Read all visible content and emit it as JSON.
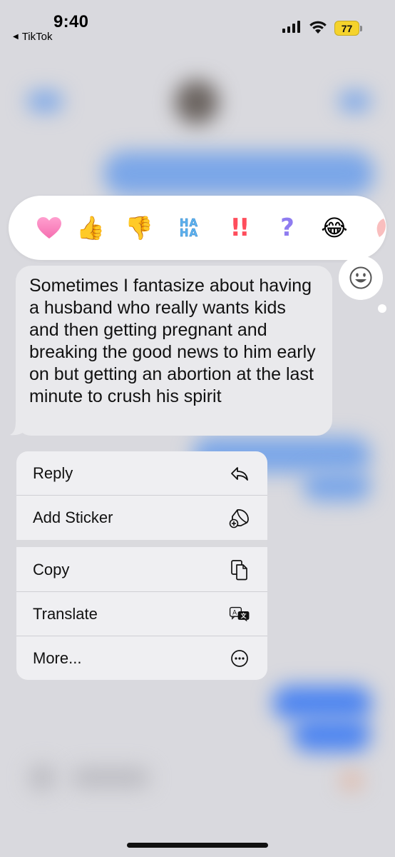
{
  "status_bar": {
    "time": "9:40",
    "back_app_label": "TikTok",
    "battery_level": "77",
    "battery_color": "#f5d32c"
  },
  "tapbacks": {
    "items": [
      {
        "name": "heart",
        "glyph": "❤️"
      },
      {
        "name": "thumbs-up",
        "glyph": "👍"
      },
      {
        "name": "thumbs-down",
        "glyph": "👎"
      },
      {
        "name": "haha",
        "glyph": "HA HA"
      },
      {
        "name": "emphasis",
        "glyph": "‼"
      },
      {
        "name": "question",
        "glyph": "?"
      },
      {
        "name": "laughing",
        "glyph": "😂"
      },
      {
        "name": "more-emoji",
        "glyph": "🫶"
      }
    ],
    "emoji_picker_icon": "smiley-icon"
  },
  "message": {
    "text": "Sometimes I fantasize about having a husband who really wants kids and then getting pregnant and breaking the good news to him early on but getting an abortion at the last minute to crush his spirit",
    "bubble_color": "#e9e9ec"
  },
  "context_menu": {
    "items": [
      {
        "label": "Reply",
        "icon": "reply-arrow-icon"
      },
      {
        "label": "Add Sticker",
        "icon": "add-sticker-icon"
      },
      {
        "label": "Copy",
        "icon": "copy-icon"
      },
      {
        "label": "Translate",
        "icon": "translate-icon"
      },
      {
        "label": "More...",
        "icon": "ellipsis-circle-icon"
      }
    ]
  }
}
